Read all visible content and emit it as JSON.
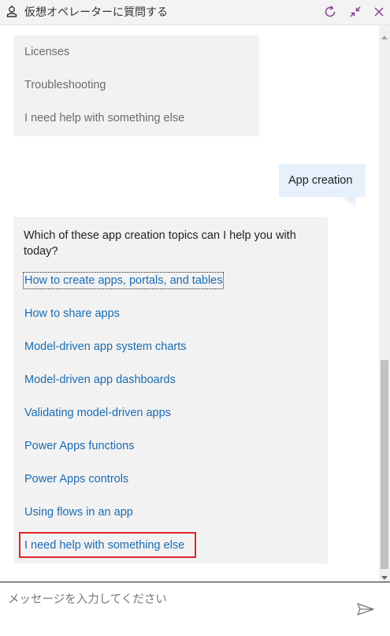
{
  "header": {
    "title": "仮想オペレーターに質問する",
    "icons": [
      "bot-icon",
      "refresh-icon",
      "minimize-icon",
      "close-icon"
    ]
  },
  "messages": {
    "bot_options_previous": [
      "Licenses",
      "Troubleshooting",
      "I need help with something else"
    ],
    "user_reply": "App creation",
    "bot_question": "Which of these app creation topics can I help you with today?",
    "bot_topics": [
      "How to create apps, portals, and tables",
      "How to share apps",
      "Model-driven app system charts",
      "Model-driven app dashboards",
      "Validating model-driven apps",
      "Power Apps functions",
      "Power Apps controls",
      "Using flows in an app",
      "I need help with something else"
    ]
  },
  "composer": {
    "placeholder": "メッセージを入力してください",
    "value": ""
  },
  "colors": {
    "accent": "#8a3c96",
    "link": "#1a6cb3",
    "bot_bubble": "#f2f2f2",
    "user_bubble": "#e6f1fb",
    "highlight": "#e02424"
  }
}
